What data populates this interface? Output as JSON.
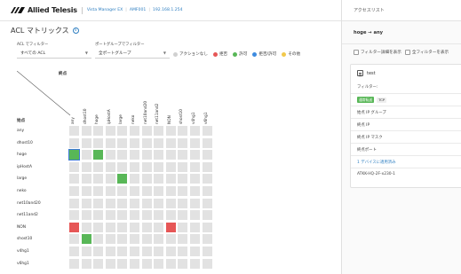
{
  "header": {
    "brand": "Allied Telesis",
    "product": "Vista Manager EX",
    "device": "AMF001",
    "ip": "192.168.1.254"
  },
  "page": {
    "title": "ACL マトリックス",
    "info_icon": "i"
  },
  "filters": {
    "acl_label": "ACL でフィルター",
    "acl_value": "すべての ACL",
    "port_label": "ポートグループでフィルター",
    "port_value": "全ポートグループ"
  },
  "legend": [
    {
      "label": "アクションなし",
      "color": "#d0d0d0"
    },
    {
      "label": "拒否",
      "color": "#e65656"
    },
    {
      "label": "許可",
      "color": "#58b757"
    },
    {
      "label": "拒否/許可",
      "color": "#3d8be0"
    },
    {
      "label": "その他",
      "color": "#f2c94c"
    }
  ],
  "matrix": {
    "dest_label": "終点",
    "src_label": "始点",
    "columns": [
      "any",
      "dhost10",
      "hoge",
      "ipHostA",
      "large",
      "neko",
      "net10and20",
      "net11and2",
      "NON",
      "shost10",
      "v4hg1",
      "v6hg1"
    ],
    "rows": [
      "any",
      "dhost10",
      "hoge",
      "ipHostA",
      "large",
      "neko",
      "net10and20",
      "net11and2",
      "NON",
      "shost10",
      "v4hg1",
      "v6hg1"
    ],
    "marked": [
      {
        "row": 2,
        "col": 0,
        "status": "許可",
        "selected": true
      },
      {
        "row": 2,
        "col": 2,
        "status": "許可"
      },
      {
        "row": 4,
        "col": 4,
        "status": "許可"
      },
      {
        "row": 8,
        "col": 0,
        "status": "拒否"
      },
      {
        "row": 8,
        "col": 8,
        "status": "拒否"
      },
      {
        "row": 9,
        "col": 1,
        "status": "許可"
      }
    ]
  },
  "panel": {
    "title": "アクセスリスト",
    "selection": "hoge → any",
    "chk_detail": "フィルター詳細を表示",
    "chk_all": "全フィルターを表示",
    "card": {
      "name": "test",
      "filter_label": "フィルター:",
      "tag_action": "通常転送",
      "tag_proto": "TCP",
      "rows": [
        "始点 IP グループ",
        "終点 IP",
        "終点 IP マスク",
        "終点ポート"
      ],
      "apply_link": "1 デバイスに適用済み",
      "device": "ATKK-HQ-2F-x230-1"
    }
  },
  "colors": {
    "accent": "#2f7fc1",
    "permit": "#58b757",
    "deny": "#e65656",
    "empty": "#e2e2e2"
  }
}
